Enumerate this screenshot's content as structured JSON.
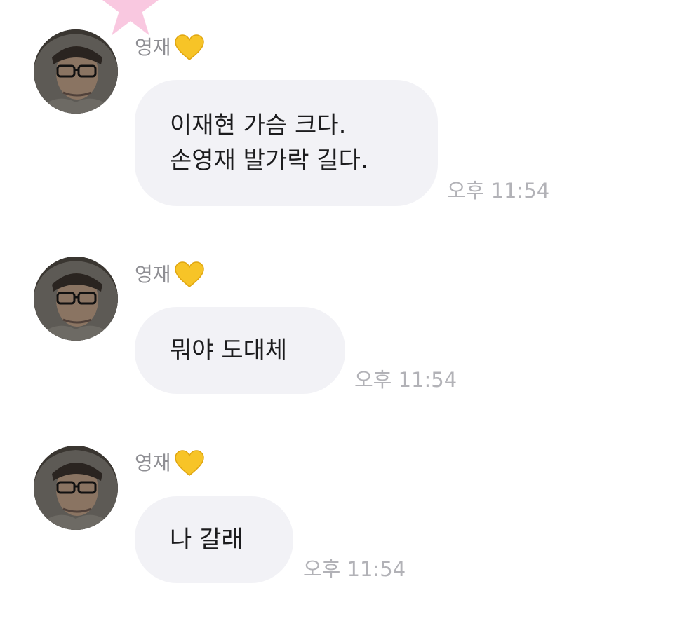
{
  "messages": [
    {
      "sender": "영재",
      "sender_icon": "yellow-heart-icon",
      "lines": [
        "이재현 가슴 크다.",
        "손영재 발가락 길다."
      ],
      "time": "오후 11:54"
    },
    {
      "sender": "영재",
      "sender_icon": "yellow-heart-icon",
      "lines": [
        "뭐야 도대체"
      ],
      "time": "오후 11:54"
    },
    {
      "sender": "영재",
      "sender_icon": "yellow-heart-icon",
      "lines": [
        "나 갈래"
      ],
      "time": "오후 11:54"
    }
  ],
  "colors": {
    "bubble": "#f2f2f6",
    "message_text": "#1c1c1e",
    "sender_name": "#8e8e93",
    "timestamp": "#b2b2b7",
    "heart": "#f7c427",
    "star": "#f9c8e0"
  }
}
